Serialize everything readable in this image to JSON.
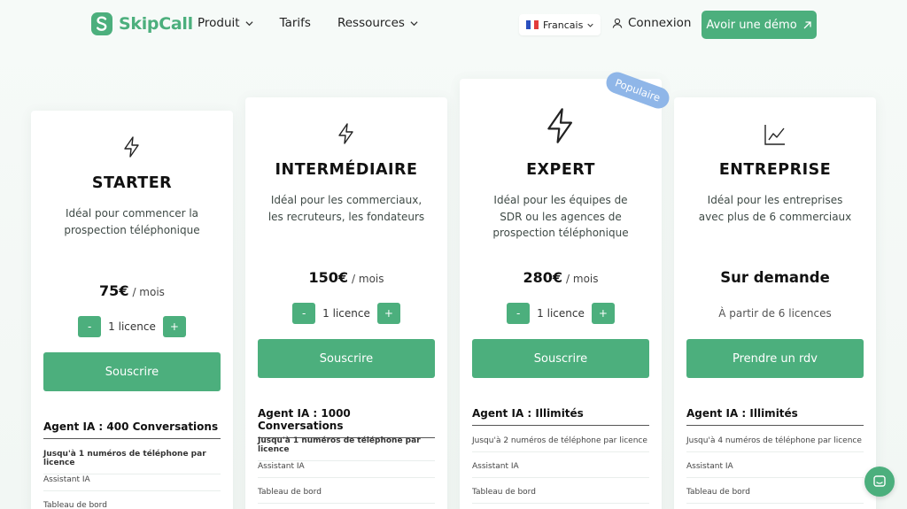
{
  "brand": {
    "name": "SkipCall",
    "color": "#4caf7d"
  },
  "nav": {
    "product": "Produit",
    "pricing": "Tarifs",
    "resources": "Ressources"
  },
  "lang": {
    "label": "Francais",
    "icon": "french-flag-icon"
  },
  "login": {
    "label": "Connexion",
    "icon": "user-icon"
  },
  "demo": {
    "label": "Avoir une démo",
    "icon": "arrow-up-right-icon"
  },
  "badge": "Populaire",
  "plans": [
    {
      "title": "STARTER",
      "description": "Idéal pour commencer la prospection téléphonique",
      "price": "75€",
      "period": "/ mois",
      "minus": "-",
      "plus": "+",
      "licenses": "1 licence",
      "cta": "Souscrire",
      "features_title": "Agent IA : 400 Conversations",
      "features": [
        "Jusqu'à 1 numéros de téléphone par licence",
        "Assistant IA",
        "Tableau de bord"
      ]
    },
    {
      "title": "INTERMÉDIAIRE",
      "description": "Idéal pour les commerciaux, les recruteurs, les fondateurs",
      "price": "150€",
      "period": "/ mois",
      "minus": "-",
      "plus": "+",
      "licenses": "1 licence",
      "cta": "Souscrire",
      "features_title": "Agent IA : 1000 Conversations",
      "features": [
        "Jusqu'à 1 numéros de téléphone par licence",
        "Assistant IA",
        "Tableau de bord"
      ]
    },
    {
      "title": "EXPERT",
      "description": "Idéal pour les équipes de SDR ou les agences de prospection téléphonique",
      "price": "280€",
      "period": "/ mois",
      "minus": "-",
      "plus": "+",
      "licenses": "1 licence",
      "cta": "Souscrire",
      "features_title": "Agent IA : Illimités",
      "features": [
        "Jusqu'à 2 numéros de téléphone par licence",
        "Assistant IA",
        "Tableau de bord"
      ]
    },
    {
      "title": "ENTREPRISE",
      "description": "Idéal pour les entreprises avec plus de 6 commerciaux",
      "price": "Sur demande",
      "note": "À partir de 6 licences",
      "cta": "Prendre un rdv",
      "features_title": "Agent IA : Illimités",
      "features": [
        "Jusqu'à 4 numéros de téléphone par licence",
        "Assistant IA",
        "Tableau de bord"
      ]
    }
  ]
}
